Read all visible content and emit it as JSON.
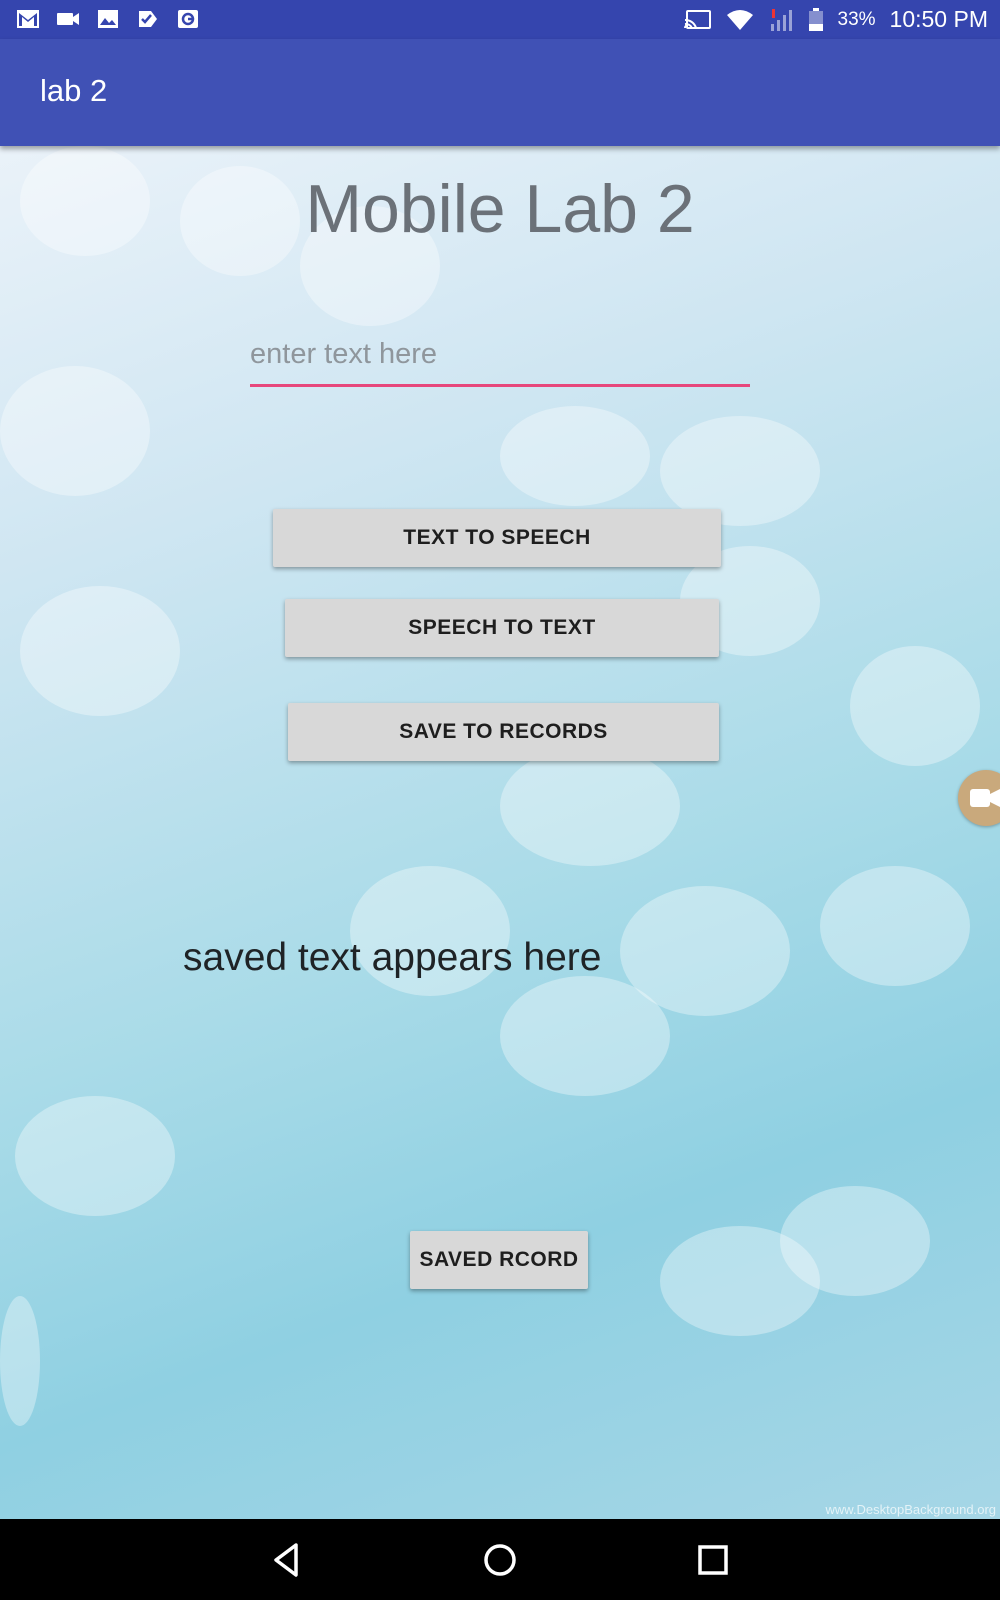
{
  "status_bar": {
    "battery": "33%",
    "time": "10:50 PM",
    "left_icons": [
      "gmail-icon",
      "video-icon",
      "image-icon",
      "task-icon",
      "maps-icon"
    ],
    "right_icons": [
      "cast-icon",
      "wifi-icon",
      "signal-icon",
      "battery-icon"
    ]
  },
  "app_bar": {
    "title": "lab 2",
    "color": "#4051b5"
  },
  "main": {
    "title": "Mobile Lab 2",
    "input": {
      "placeholder": "enter text here",
      "value": ""
    },
    "buttons": {
      "text_to_speech": "TEXT TO SPEECH",
      "speech_to_text": "SPEECH TO TEXT",
      "save_to_records": "SAVE TO RECORDS",
      "saved_record": "SAVED RCORD"
    },
    "saved_text": "saved text appears here",
    "watermark": "www.DesktopBackground.org"
  },
  "colors": {
    "accent": "#e7477c",
    "status_bar": "#3545ae",
    "button": "#d8d8d8"
  },
  "nav_bar": {
    "icons": [
      "back-icon",
      "home-icon",
      "recents-icon"
    ]
  }
}
